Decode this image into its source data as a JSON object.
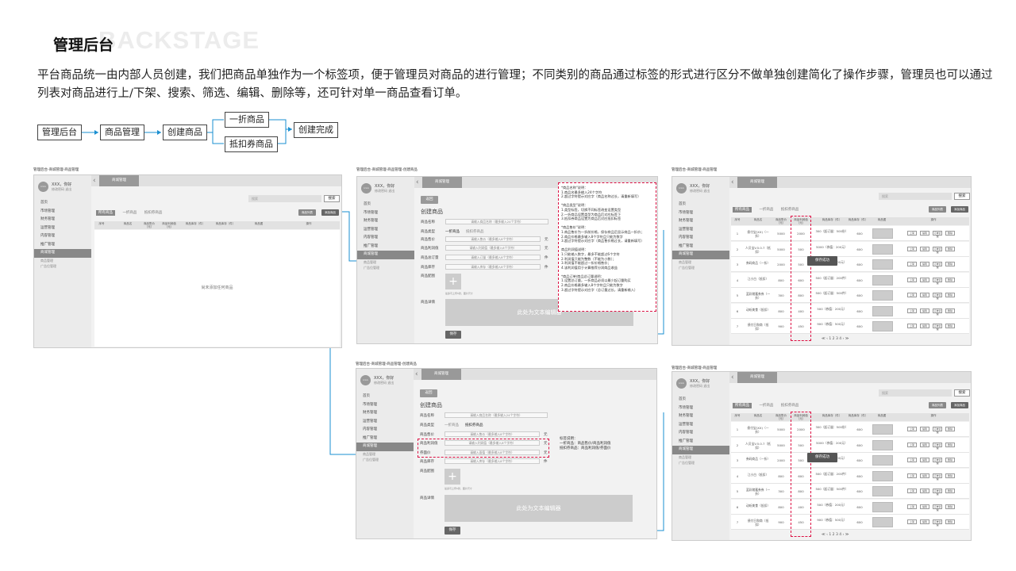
{
  "header": {
    "bg_word": "BACKSTAGE",
    "title": "管理后台",
    "desc": "平台商品统一由内部人员创建，我们把商品单独作为一个标签项，便于管理员对商品的进行管理；不同类别的商品通过标签的形式进行区分不做单独创建简化了操作步骤，管理员也可以通过列表对商品进行上/下架、搜索、筛选、编辑、删除等，还可针对单一商品查看订单。"
  },
  "flow": [
    "管理后台",
    "商品管理",
    "创建商品",
    "一折商品",
    "抵扣券商品",
    "创建完成"
  ],
  "captions": {
    "list": "管理后台-商城管理-商品管理",
    "create": "管理后台-商城管理-商品管理-创建商品",
    "saved": "管理后台-商城管理-商品管理"
  },
  "common": {
    "avatar": "icon",
    "user": "XXX，你好",
    "user_actions": "修改密码  退出",
    "tab": "商城管理",
    "menu": [
      "首页",
      "市场管理",
      "财务管理",
      "运营管理",
      "内容管理",
      "推广管理",
      "商城管理"
    ],
    "submenu": [
      "商品管理",
      "广告位管理"
    ],
    "search_placeholder": "搜索",
    "search_btn": "搜索",
    "tabs": [
      "所有商品",
      "一折商品",
      "抵扣券商品"
    ],
    "btn_filter": "商品列表",
    "btn_add": "添加商品",
    "headers": [
      "序号",
      "商品名",
      "商品售价（元）",
      "商品利润值（元）",
      "商品库存（件）",
      "商品库存（件）",
      "商品图",
      "操作"
    ],
    "empty": "尚未添加任何商品",
    "ops": [
      "上架",
      "编辑",
      "订单管理",
      "删除"
    ],
    "toast": "保存成功",
    "pager": "≪ ‹ 1 2 3 4 › ≫"
  },
  "form": {
    "back": "返回",
    "title": "创建商品",
    "labels": [
      "商品名称",
      "商品类型",
      "商品售价",
      "商品利润值",
      "商品总订量",
      "商品库存",
      "商品配图",
      "商品详情"
    ],
    "labels_coupon": [
      "商品名称",
      "商品类型",
      "商品售价",
      "商品利润值",
      "券面价",
      "商品库存",
      "商品配图",
      "商品详情"
    ],
    "name_ph": "请输入商品名称（最多输入24个字符）",
    "types": [
      "一折商品",
      "抵扣券商品"
    ],
    "price_ph": "请输入售价（最多输入8个字符）",
    "profit_ph": "请输入利润值（最多输入8个字符）",
    "order_ph": "请输入订量（最多输入8个字符）",
    "stock_ph": "请输入库存（最多输入8个字符）",
    "coupon_ph": "请输入面值（最多输入8个字符）",
    "units": [
      "元",
      "元",
      "件",
      "件"
    ],
    "img_hint": "最多可上传5张，图片尺寸",
    "editor": "此处为文本编辑器",
    "save": "保存"
  },
  "notes": {
    "create": "*商品名称\"说明：\n1.商品名最多输入24个字符\n2.超过字符提示对应字（商品名称过长，请重新填写）\n\n*商品类型\"说明：\n1.类型标签，切换不同标签改变设置类型\n2.一折商品设置类型为商品后对应标签下\n3.抵扣券商品设置为商品后对应抵扣标签\n\n*商品售价\"说明：\n1.商品售价为一折前价格，保存商品后显示商品一折价；\n2.商品价格最多输入8个字符且只能为数字\n3.超过字符提示对应字（商品售价格过长，请重新填写）\n\n商品利润值说明：\n1.只能输入数字，最多不能超过6个字符\n2.利润值只能为整数（不能为小数）；\n3.利润值不能超过一折价格售价；\n4.该利润值用于计算推荐分润商品收益\n\n*商品订单/商品总订量说明：\n1.设置总订量，一折商品必须以最少起订量购买\n2.商品价格最多输入8个字符且只能为数字\n3.超过字符提示对应字（总订量过长，请重新输入）",
    "coupon": "标签说明：\n一折商品：商品售价/商品利润值\n抵扣券商品：商品利润值/券面价"
  },
  "rows": [
    {
      "no": "1",
      "name": "债付宝(XX)（一折）",
      "price": "5000",
      "profit": "2000",
      "sale": "300（起订量：500份）",
      "stock": "600"
    },
    {
      "no": "2",
      "name": "人贝宝V.5.0.7（抵扣）",
      "price": "5000",
      "profit": "500",
      "sale": "5000（券值：200元）",
      "stock": "600"
    },
    {
      "no": "3",
      "name": "券码商品（一折）",
      "price": "2000",
      "profit": "500",
      "sale": "500（券值：200元）",
      "stock": "600"
    },
    {
      "no": "4",
      "name": "江小白（抵扣）",
      "price": "800",
      "profit": "600",
      "sale": "500（起订量：200件）",
      "stock": "600"
    },
    {
      "no": "5",
      "name": "蓝彩储蓄券券（一折）",
      "price": "300",
      "profit": "800",
      "sale": "500（起订量：500件）",
      "stock": "600"
    },
    {
      "no": "6",
      "name": "动听美食（抵扣）",
      "price": "800",
      "profit": "400",
      "sale": "500（券值：200元）",
      "stock": "600"
    },
    {
      "no": "7",
      "name": "债付日和商（抵扣）",
      "price": "900",
      "profit": "450",
      "sale": "900（券值：500元）",
      "stock": "600"
    }
  ]
}
